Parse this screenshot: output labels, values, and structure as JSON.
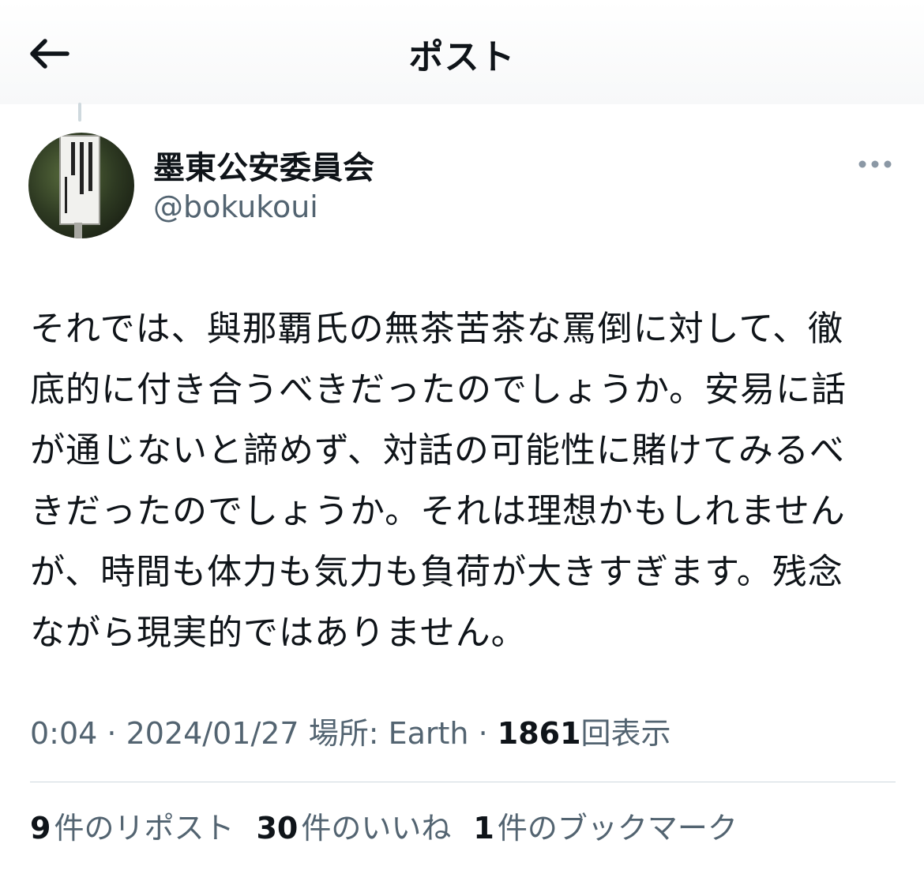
{
  "header": {
    "back_icon": "arrow-left-icon",
    "title": "ポスト"
  },
  "author": {
    "avatar_icon": "sign-photo-avatar",
    "name": "墨東公安委員会",
    "handle": "@bokukoui",
    "more_icon": "more-horizontal-icon"
  },
  "post": {
    "lines": [
      "それでは、與那覇氏の無茶苦茶な罵倒に対して、徹",
      "底的に付き合うべきだったのでしょうか。安易に話",
      "が通じないと諦めず、対話の可能性に賭けてみるべ",
      "きだったのでしょうか。それは理想かもしれません",
      "が、時間も体力も気力も負荷が大きすぎます。残念",
      "ながら現実的ではありません。"
    ]
  },
  "meta": {
    "time": "0:04",
    "sep1": " · ",
    "date": "2024/01/27",
    "location": " 場所: Earth",
    "sep2": " · ",
    "views_count": "1861",
    "views_label": "回表示"
  },
  "stats": {
    "reposts_count": "9",
    "reposts_label": "件のリポスト",
    "likes_count": "30",
    "likes_label": "件のいいね",
    "bookmarks_count": "1",
    "bookmarks_label": "件のブックマーク"
  },
  "colors": {
    "text": "#0f1419",
    "secondary": "#536471",
    "divider": "#cfd9de"
  }
}
